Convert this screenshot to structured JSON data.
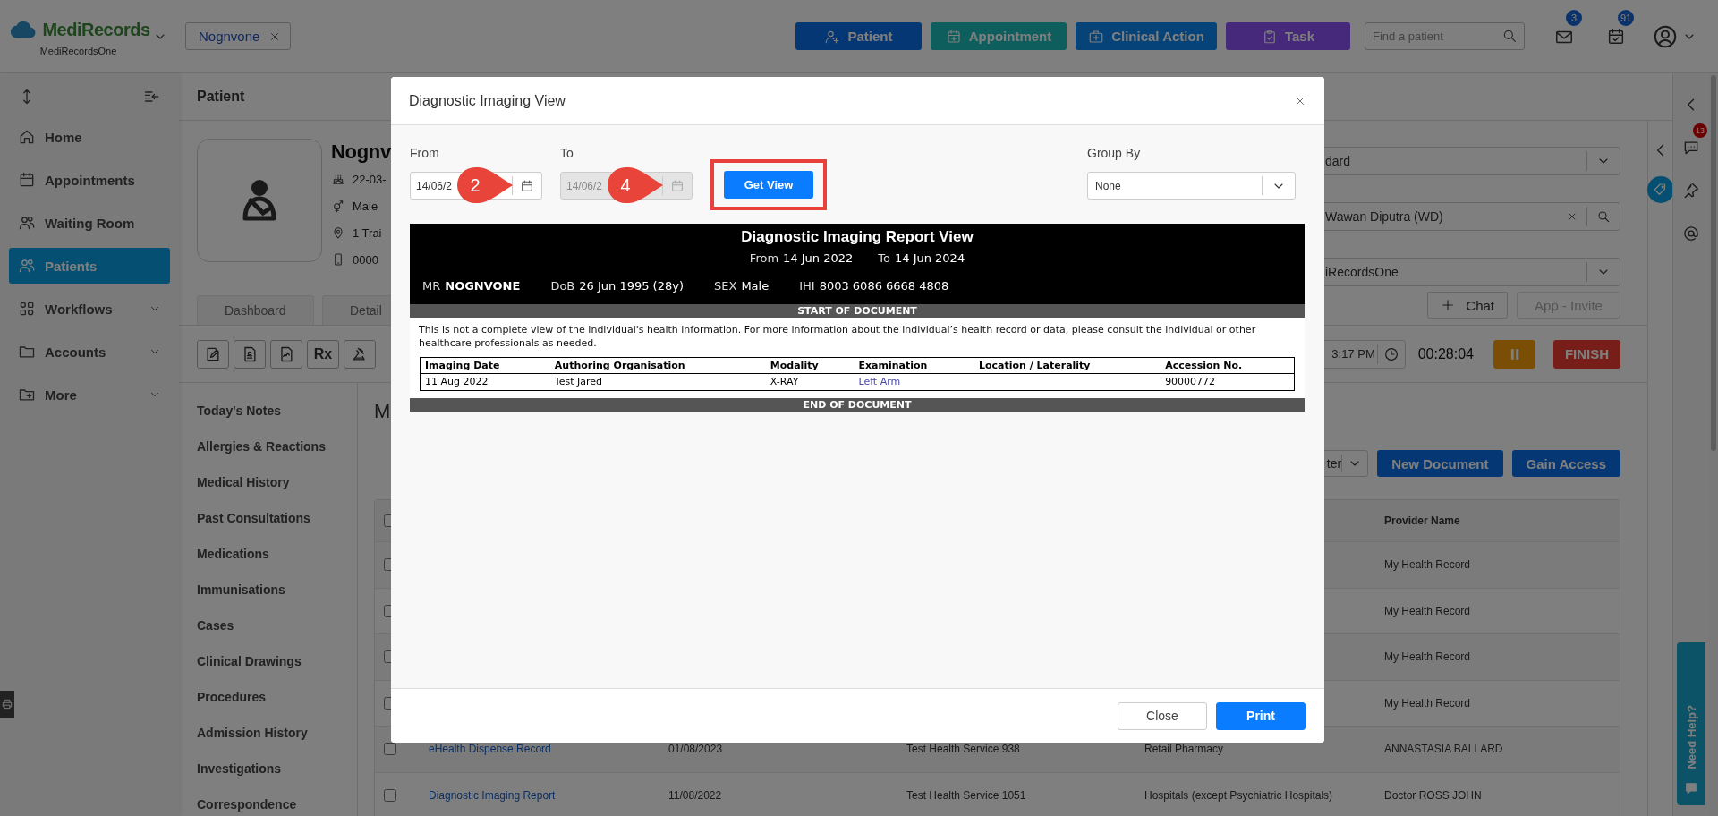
{
  "header": {
    "logo": {
      "name": "MediRecords",
      "subtitle": "MediRecordsOne"
    },
    "open_patient": {
      "label": "Nognvone"
    },
    "actions": [
      {
        "label": "Patient"
      },
      {
        "label": "Appointment"
      },
      {
        "label": "Clinical Action"
      },
      {
        "label": "Task"
      }
    ],
    "search": {
      "placeholder": "Find a patient"
    },
    "notifications": [
      {
        "count": "3"
      },
      {
        "count": "91"
      }
    ]
  },
  "sidebar": {
    "items": [
      {
        "label": "Home",
        "kind": "link",
        "selected": false
      },
      {
        "label": "Appointments",
        "kind": "link",
        "selected": false
      },
      {
        "label": "Waiting Room",
        "kind": "link",
        "selected": false
      },
      {
        "label": "Patients",
        "kind": "link",
        "selected": true
      },
      {
        "label": "Workflows",
        "kind": "group",
        "selected": false
      },
      {
        "label": "Accounts",
        "kind": "group",
        "selected": false
      },
      {
        "label": "More",
        "kind": "group",
        "selected": false
      }
    ]
  },
  "page": {
    "title": "Patient",
    "patient": {
      "name": "Nognv",
      "details": [
        "22-03-",
        "Male",
        "1 Trai",
        "0000"
      ]
    },
    "tabs": [
      {
        "label": "Dashboard",
        "selected": false
      },
      {
        "label": "Detail",
        "selected": false
      }
    ],
    "fields": [
      {
        "kind": "select",
        "value": "dard"
      },
      {
        "kind": "search",
        "value": "Wawan Diputra (WD)"
      },
      {
        "kind": "select",
        "value": "iRecordsOne"
      }
    ],
    "buttons": [
      {
        "label": "Chat",
        "disabled": false
      },
      {
        "label": "App - Invite",
        "disabled": true
      }
    ],
    "toolbar": [
      {
        "kind": "icon"
      },
      {
        "kind": "icon"
      },
      {
        "kind": "icon"
      },
      {
        "kind": "text",
        "text": "Rx"
      },
      {
        "kind": "icon"
      }
    ],
    "consultation": {
      "time": "3:17 PM",
      "timer": "00:28:04",
      "finish": "FINISH"
    },
    "nav": [
      "Today's Notes",
      "Allergies & Reactions",
      "Medical History",
      "Past Consultations",
      "Medications",
      "Immunisations",
      "Cases",
      "Clinical Drawings",
      "Procedures",
      "Admission History",
      "Investigations",
      "Correspondence"
    ],
    "documents": {
      "heading": "M",
      "filter": {
        "value": "ter"
      },
      "buttons": [
        "New Document",
        "Gain Access"
      ],
      "table": {
        "header_checked": false,
        "provider_heading": "Provider Name",
        "rows": [
          {
            "checked": false,
            "provider_name": "My Health Record"
          },
          {
            "checked": false,
            "provider_name": "My Health Record"
          },
          {
            "checked": false,
            "provider_name": "My Health Record"
          },
          {
            "checked": false,
            "provider_name": "My Health Record"
          },
          {
            "checked": false,
            "document": "eHealth Dispense Record",
            "date": "01/08/2023",
            "column_4": "Test Health Service 938",
            "column_5": "Retail Pharmacy",
            "provider_name": "ANNASTASIA BALLARD"
          },
          {
            "checked": false,
            "document": "Diagnostic Imaging Report",
            "date": "11/08/2022",
            "column_4": "Test Health Service 1051",
            "column_5": "Hospitals (except Psychiatric Hospitals)",
            "provider_name": "Doctor ROSS JOHN"
          }
        ]
      }
    }
  },
  "right_rail": {
    "chat_badge": "13"
  },
  "help": {
    "label": "Need Help?"
  },
  "modal": {
    "title": "Diagnostic Imaging View",
    "dates": [
      {
        "label": "From",
        "value": "14/06/2",
        "disabled": false
      },
      {
        "label": "To",
        "value": "14/06/2",
        "disabled": true
      }
    ],
    "get_view": "Get View",
    "group_by": {
      "label": "Group By",
      "value": "None"
    },
    "report": {
      "title": "Diagnostic Imaging Report View",
      "range": [
        {
          "label": "From",
          "value": "14 Jun 2022"
        },
        {
          "label": "To",
          "value": "14 Jun 2024"
        }
      ],
      "patient": [
        {
          "label": "MR",
          "value": "NOGNVONE",
          "bold": true
        },
        {
          "label": "DoB",
          "value": "26 Jun 1995 (28y)"
        },
        {
          "label": "SEX",
          "value": "Male"
        },
        {
          "label": "IHI",
          "value": "8003 6086 6668 4808"
        }
      ],
      "start": "START OF DOCUMENT",
      "notice": "This is not a complete view of the individual's health information. For more information about the individual’s health record or data, please consult the individual or other healthcare professionals as needed.",
      "columns": [
        "Imaging Date",
        "Authoring Organisation",
        "Modality",
        "Examination",
        "Location / Laterality",
        "Accession No."
      ],
      "rows": [
        [
          {
            "text": "11 Aug 2022"
          },
          {
            "text": "Test Jared"
          },
          {
            "text": "X-RAY"
          },
          {
            "text": "Left Arm",
            "kind": "link"
          },
          null,
          {
            "text": "90000772"
          }
        ]
      ],
      "end": "END OF DOCUMENT"
    },
    "footer": [
      {
        "label": "Close",
        "kind": "secondary"
      },
      {
        "label": "Print",
        "kind": "primary"
      }
    ]
  },
  "step_markers": [
    {
      "label": "2"
    },
    {
      "label": "4"
    }
  ]
}
